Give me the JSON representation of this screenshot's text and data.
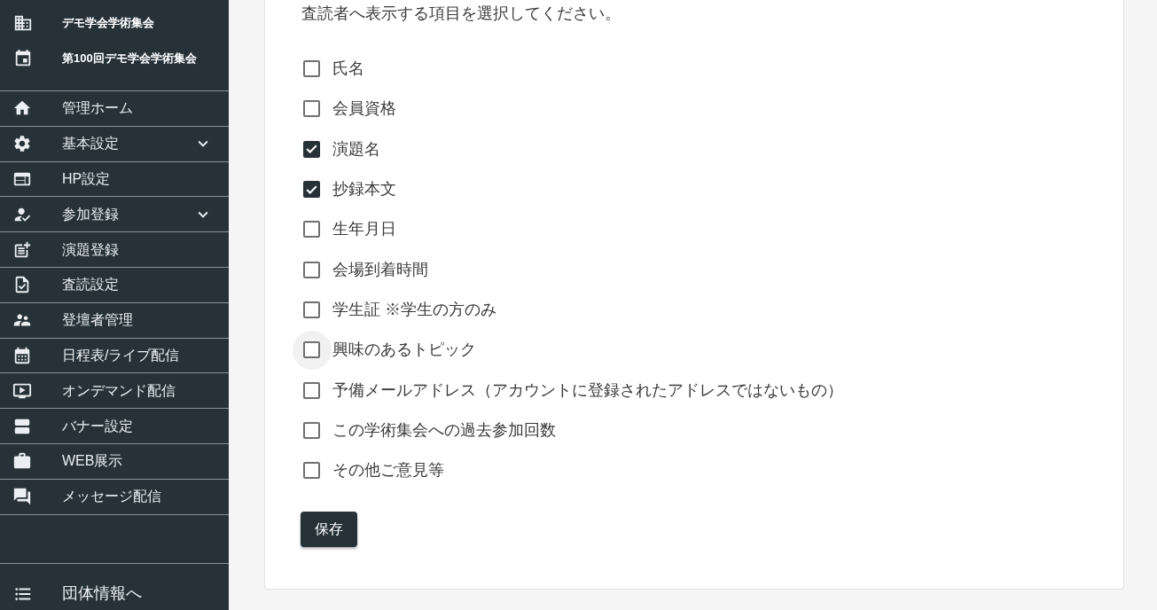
{
  "sidebar": {
    "organization": "デモ学会学術集会",
    "event": "第100回デモ学会学術集会",
    "menu": [
      {
        "label": "管理ホーム",
        "kind": "link"
      },
      {
        "label": "基本設定",
        "kind": "group"
      },
      {
        "label": "HP設定",
        "kind": "link"
      },
      {
        "label": "参加登録",
        "kind": "group"
      },
      {
        "label": "演題登録",
        "kind": "link"
      },
      {
        "label": "査読設定",
        "kind": "link"
      },
      {
        "label": "登壇者管理",
        "kind": "link"
      },
      {
        "label": "日程表/ライブ配信",
        "kind": "link"
      },
      {
        "label": "オンデマンド配信",
        "kind": "link"
      },
      {
        "label": "バナー設定",
        "kind": "link"
      },
      {
        "label": "WEB展示",
        "kind": "link"
      },
      {
        "label": "メッセージ配信",
        "kind": "link"
      }
    ],
    "footer_link": "団体情報へ"
  },
  "form": {
    "instruction": "査読者へ表示する項目を選択してください。",
    "options": [
      {
        "label": "氏名",
        "checked": false,
        "hovered": false
      },
      {
        "label": "会員資格",
        "checked": false,
        "hovered": false
      },
      {
        "label": "演題名",
        "checked": true,
        "hovered": false
      },
      {
        "label": "抄録本文",
        "checked": true,
        "hovered": false
      },
      {
        "label": "生年月日",
        "checked": false,
        "hovered": false
      },
      {
        "label": "会場到着時間",
        "checked": false,
        "hovered": false
      },
      {
        "label": "学生証 ※学生の方のみ",
        "checked": false,
        "hovered": false
      },
      {
        "label": "興味のあるトピック",
        "checked": false,
        "hovered": true
      },
      {
        "label": "予備メールアドレス（アカウントに登録されたアドレスではないもの）",
        "checked": false,
        "hovered": false
      },
      {
        "label": "この学術集会への過去参加回数",
        "checked": false,
        "hovered": false
      },
      {
        "label": "その他ご意見等",
        "checked": false,
        "hovered": false
      }
    ],
    "save_button": "保存"
  }
}
